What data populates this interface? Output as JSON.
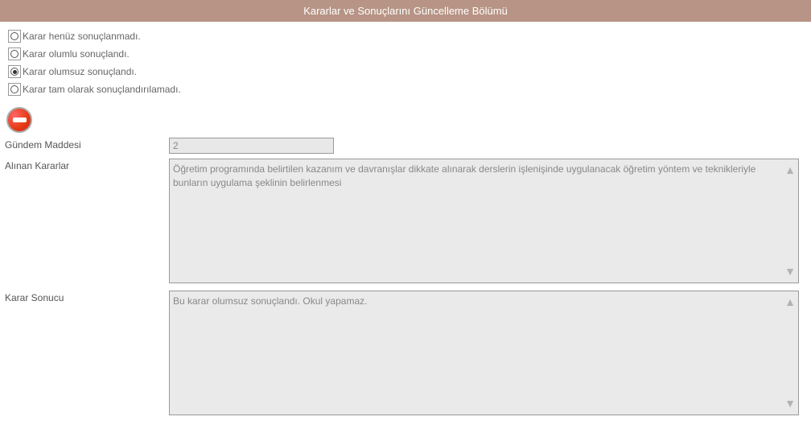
{
  "header": {
    "title": "Kararlar ve Sonuçlarını Güncelleme Bölümü"
  },
  "radios": {
    "options": [
      {
        "label": "Karar henüz sonuçlanmadı.",
        "selected": false
      },
      {
        "label": "Karar olumlu sonuçlandı.",
        "selected": false
      },
      {
        "label": "Karar olumsuz sonuçlandı.",
        "selected": true
      },
      {
        "label": "Karar tam olarak sonuçlandırılamadı.",
        "selected": false
      }
    ]
  },
  "form": {
    "gundem_label": "Gündem Maddesi",
    "gundem_value": "2",
    "alinan_label": "Alınan Kararlar",
    "alinan_value": "Öğretim programında belirtilen kazanım ve davranışlar dikkate alınarak derslerin işlenişinde uygulanacak öğretim yöntem ve teknikleriyle bunların uygulama şeklinin belirlenmesi",
    "sonuc_label": "Karar Sonucu",
    "sonuc_value": "Bu karar olumsuz sonuçlandı. Okul yapamaz."
  }
}
